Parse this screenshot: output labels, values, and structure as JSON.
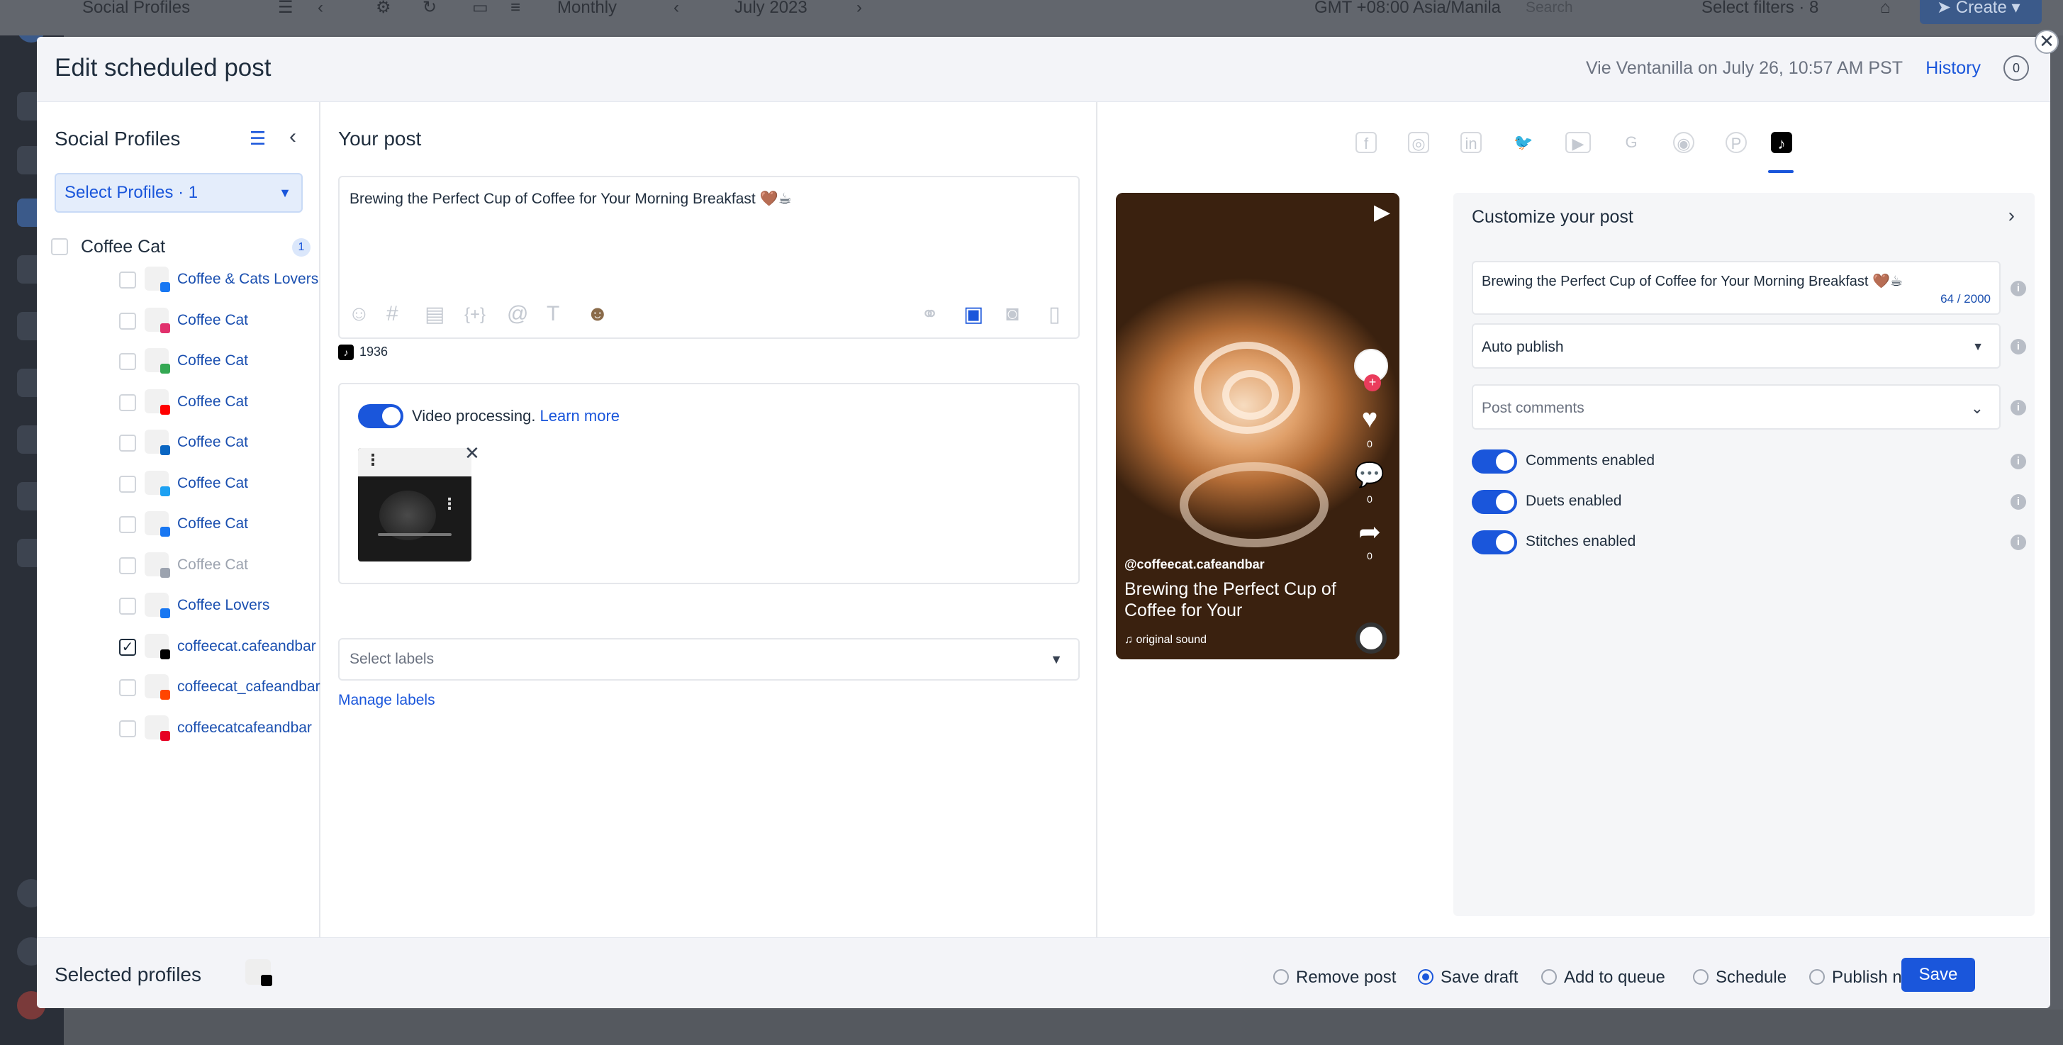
{
  "background": {
    "app_title": "Social Profiles",
    "view_mode": "Monthly",
    "month": "July 2023",
    "timezone": "GMT +08:00 Asia/Manila",
    "search_placeholder": "Search",
    "filters": "Select filters · 8",
    "create_label": "Create"
  },
  "modal": {
    "title": "Edit scheduled post",
    "editor_meta": "Vie Ventanilla on July 26, 10:57 AM PST",
    "history_label": "History",
    "notification_count": "0",
    "close_glyph": "✕"
  },
  "left_panel": {
    "title": "Social Profiles",
    "select_profiles_label": "Select Profiles · 1",
    "group": {
      "name": "Coffee Cat",
      "selected_count": "1"
    },
    "profiles": [
      {
        "name": "Coffee & Cats Lovers",
        "network": "facebook",
        "checked": false
      },
      {
        "name": "Coffee Cat",
        "network": "instagram",
        "checked": false
      },
      {
        "name": "Coffee Cat",
        "network": "google",
        "checked": false
      },
      {
        "name": "Coffee Cat",
        "network": "youtube",
        "checked": false
      },
      {
        "name": "Coffee Cat",
        "network": "linkedin",
        "checked": false
      },
      {
        "name": "Coffee Cat",
        "network": "twitter",
        "checked": false
      },
      {
        "name": "Coffee Cat",
        "network": "facebook",
        "checked": false
      },
      {
        "name": "Coffee Cat",
        "network": "google-business",
        "checked": false
      },
      {
        "name": "Coffee Lovers",
        "network": "facebook",
        "checked": false
      },
      {
        "name": "coffeecat.cafeandbar",
        "network": "tiktok",
        "checked": true
      },
      {
        "name": "coffeecat_cafeandbar",
        "network": "reddit",
        "checked": false
      },
      {
        "name": "coffeecatcafeandbar",
        "network": "pinterest",
        "checked": false
      }
    ]
  },
  "middle_panel": {
    "title": "Your post",
    "post_text": "Brewing the Perfect Cup of Coffee for Your Morning Breakfast 🤎☕",
    "char_count": "1936",
    "video_processing_label": "Video processing.",
    "learn_more_label": "Learn more",
    "labels_placeholder": "Select labels",
    "manage_labels": "Manage labels"
  },
  "right_panel": {
    "networks": [
      "facebook",
      "instagram",
      "linkedin",
      "twitter",
      "youtube",
      "google",
      "reddit",
      "pinterest",
      "tiktok"
    ],
    "active_network": "tiktok",
    "preview": {
      "handle": "@coffeecat.cafeandbar",
      "caption": "Brewing the Perfect Cup of Coffee for Your",
      "sound": "original sound",
      "likes": "0",
      "comments": "0",
      "shares": "0"
    },
    "customize": {
      "title": "Customize your post",
      "caption": "Brewing the Perfect Cup of Coffee for Your Morning Breakfast 🤎☕",
      "caption_count": "64 / 2000",
      "publish_mode": "Auto publish",
      "post_comments_placeholder": "Post comments",
      "options": [
        {
          "label": "Comments enabled",
          "on": true
        },
        {
          "label": "Duets enabled",
          "on": true
        },
        {
          "label": "Stitches enabled",
          "on": true
        }
      ]
    }
  },
  "footer": {
    "selected_profiles_label": "Selected profiles",
    "actions": [
      {
        "label": "Remove post",
        "selected": false
      },
      {
        "label": "Save draft",
        "selected": true
      },
      {
        "label": "Add to queue",
        "selected": false
      },
      {
        "label": "Schedule",
        "selected": false
      },
      {
        "label": "Publish now",
        "selected": false
      }
    ],
    "save_label": "Save"
  },
  "colors": {
    "accent": "#1a56db",
    "tiktok": "#000000",
    "facebook": "#1877f2",
    "instagram": "#e1306c",
    "youtube": "#ff0000",
    "linkedin": "#0a66c2",
    "twitter": "#1da1f2",
    "reddit": "#ff4500",
    "pinterest": "#e60023"
  }
}
